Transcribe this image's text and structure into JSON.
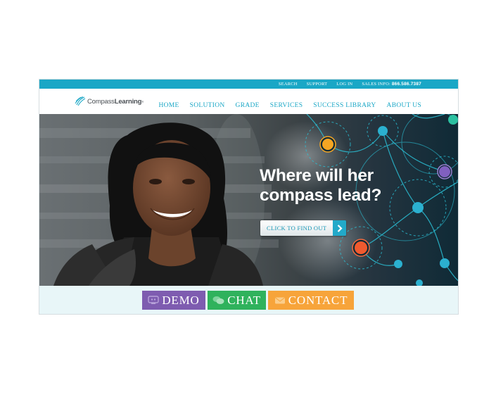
{
  "topbar": {
    "links": [
      "SEARCH",
      "SUPPORT",
      "LOG IN"
    ],
    "sales_label": "SALES INFO:",
    "sales_phone": "866.586.7387"
  },
  "logo": {
    "text_light": "Compass",
    "text_bold": "Learning",
    "reg": "®"
  },
  "nav": [
    "HOME",
    "SOLUTION",
    "GRADE",
    "SERVICES",
    "SUCCESS LIBRARY",
    "ABOUT US"
  ],
  "hero": {
    "headline_line1": "Where will her",
    "headline_line2": "compass lead?",
    "cta_label": "CLICK TO FIND OUT"
  },
  "actions": {
    "demo": "DEMO",
    "chat": "CHAT",
    "contact": "CONTACT"
  },
  "colors": {
    "accent": "#1aa7c6",
    "demo": "#7e5cb0",
    "chat": "#2fb25c",
    "contact": "#f7a43a"
  }
}
